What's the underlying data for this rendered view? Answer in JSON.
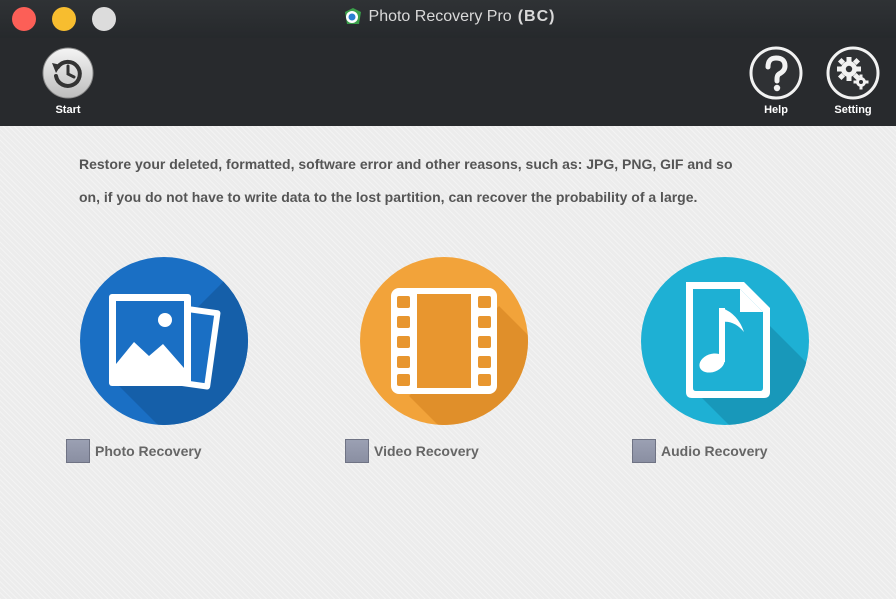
{
  "window": {
    "title": "Photo Recovery Pro",
    "title_suffix": "(BC)"
  },
  "toolbar": {
    "start_label": "Start",
    "help_label": "Help",
    "setting_label": "Setting"
  },
  "main": {
    "description_line1": "Restore your deleted, formatted, software error and other reasons, such as: JPG, PNG, GIF and so",
    "description_line2": "on, if you do not have to write data to the lost partition, can recover the probability of a large.",
    "options": [
      {
        "label": "Photo Recovery",
        "icon": "photo-icon",
        "color": "#1a6fc4",
        "checked": false
      },
      {
        "label": "Video Recovery",
        "icon": "film-icon",
        "color": "#f2a33a",
        "checked": false
      },
      {
        "label": "Audio Recovery",
        "icon": "music-file-icon",
        "color": "#1eb0d4",
        "checked": false
      }
    ]
  },
  "colors": {
    "titlebar": "#2a2d30",
    "toolbar": "#282a2d",
    "background": "#ececec",
    "close": "#fc5f57",
    "minimize": "#f7bd2f",
    "zoom": "#dcdcdc"
  }
}
